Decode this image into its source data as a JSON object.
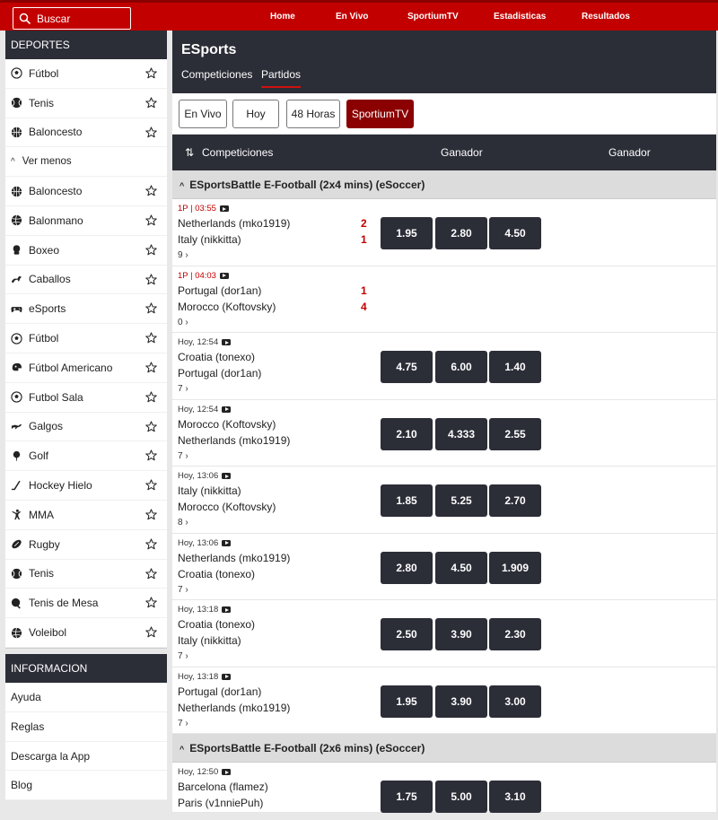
{
  "search": {
    "placeholder": "Buscar"
  },
  "nav": [
    "Home",
    "En Vivo",
    "SportiumTV",
    "Estadisticas",
    "Resultados"
  ],
  "sidebar": {
    "deportes_title": "DEPORTES",
    "top_items": [
      {
        "label": "Fútbol",
        "icon": "soccer-ball-icon"
      },
      {
        "label": "Tenis",
        "icon": "tennis-ball-icon"
      },
      {
        "label": "Baloncesto",
        "icon": "basketball-icon"
      }
    ],
    "toggle_label": "Ver menos",
    "items": [
      {
        "label": "Baloncesto",
        "icon": "basketball-icon"
      },
      {
        "label": "Balonmano",
        "icon": "handball-icon"
      },
      {
        "label": "Boxeo",
        "icon": "boxing-glove-icon"
      },
      {
        "label": "Caballos",
        "icon": "horse-icon"
      },
      {
        "label": "eSports",
        "icon": "gamepad-icon"
      },
      {
        "label": "Fútbol",
        "icon": "soccer-ball-icon"
      },
      {
        "label": "Fútbol Americano",
        "icon": "american-football-helmet-icon"
      },
      {
        "label": "Futbol Sala",
        "icon": "futsal-ball-icon"
      },
      {
        "label": "Galgos",
        "icon": "greyhound-icon"
      },
      {
        "label": "Golf",
        "icon": "golf-icon"
      },
      {
        "label": "Hockey Hielo",
        "icon": "hockey-stick-icon"
      },
      {
        "label": "MMA",
        "icon": "mma-fighter-icon"
      },
      {
        "label": "Rugby",
        "icon": "rugby-ball-icon"
      },
      {
        "label": "Tenis",
        "icon": "tennis-ball-icon"
      },
      {
        "label": "Tenis de Mesa",
        "icon": "table-tennis-icon"
      },
      {
        "label": "Voleibol",
        "icon": "volleyball-icon"
      }
    ],
    "info_title": "INFORMACION",
    "info_items": [
      "Ayuda",
      "Reglas",
      "Descarga la App",
      "Blog"
    ]
  },
  "main": {
    "title": "ESports",
    "tabs": [
      "Competiciones",
      "Partidos"
    ],
    "active_tab": "Partidos",
    "filters": [
      "En Vivo",
      "Hoy",
      "48 Horas",
      "SportiumTV"
    ],
    "active_filter": "SportiumTV",
    "table_head": {
      "competitions": "Competiciones",
      "col1": "Ganador",
      "col2": "Ganador"
    },
    "competitions": [
      {
        "name": "ESportsBattle E-Football (2x4 mins) (eSoccer)",
        "matches": [
          {
            "time": "1P | 03:55",
            "live": true,
            "home": "Netherlands (mko1919)",
            "away": "Italy (nikkitta)",
            "home_score": "2",
            "away_score": "1",
            "more": "9",
            "odds": [
              "1.95",
              "2.80",
              "4.50"
            ]
          },
          {
            "time": "1P | 04:03",
            "live": true,
            "home": "Portugal (dor1an)",
            "away": "Morocco (Koftovsky)",
            "home_score": "1",
            "away_score": "4",
            "more": "0",
            "odds": []
          },
          {
            "time": "Hoy, 12:54",
            "live": false,
            "home": "Croatia (tonexo)",
            "away": "Portugal (dor1an)",
            "more": "7",
            "odds": [
              "4.75",
              "6.00",
              "1.40"
            ]
          },
          {
            "time": "Hoy, 12:54",
            "live": false,
            "home": "Morocco (Koftovsky)",
            "away": "Netherlands (mko1919)",
            "more": "7",
            "odds": [
              "2.10",
              "4.333",
              "2.55"
            ]
          },
          {
            "time": "Hoy, 13:06",
            "live": false,
            "home": "Italy (nikkitta)",
            "away": "Morocco (Koftovsky)",
            "more": "8",
            "odds": [
              "1.85",
              "5.25",
              "2.70"
            ]
          },
          {
            "time": "Hoy, 13:06",
            "live": false,
            "home": "Netherlands (mko1919)",
            "away": "Croatia (tonexo)",
            "more": "7",
            "odds": [
              "2.80",
              "4.50",
              "1.909"
            ]
          },
          {
            "time": "Hoy, 13:18",
            "live": false,
            "home": "Croatia (tonexo)",
            "away": "Italy (nikkitta)",
            "more": "7",
            "odds": [
              "2.50",
              "3.90",
              "2.30"
            ]
          },
          {
            "time": "Hoy, 13:18",
            "live": false,
            "home": "Portugal (dor1an)",
            "away": "Netherlands (mko1919)",
            "more": "7",
            "odds": [
              "1.95",
              "3.90",
              "3.00"
            ]
          }
        ]
      },
      {
        "name": "ESportsBattle E-Football (2x6 mins) (eSoccer)",
        "matches": [
          {
            "time": "Hoy, 12:50",
            "live": false,
            "home": "Barcelona (flamez)",
            "away": "Paris (v1nniePuh)",
            "more": "",
            "odds": [
              "1.75",
              "5.00",
              "3.10"
            ]
          }
        ]
      }
    ]
  }
}
